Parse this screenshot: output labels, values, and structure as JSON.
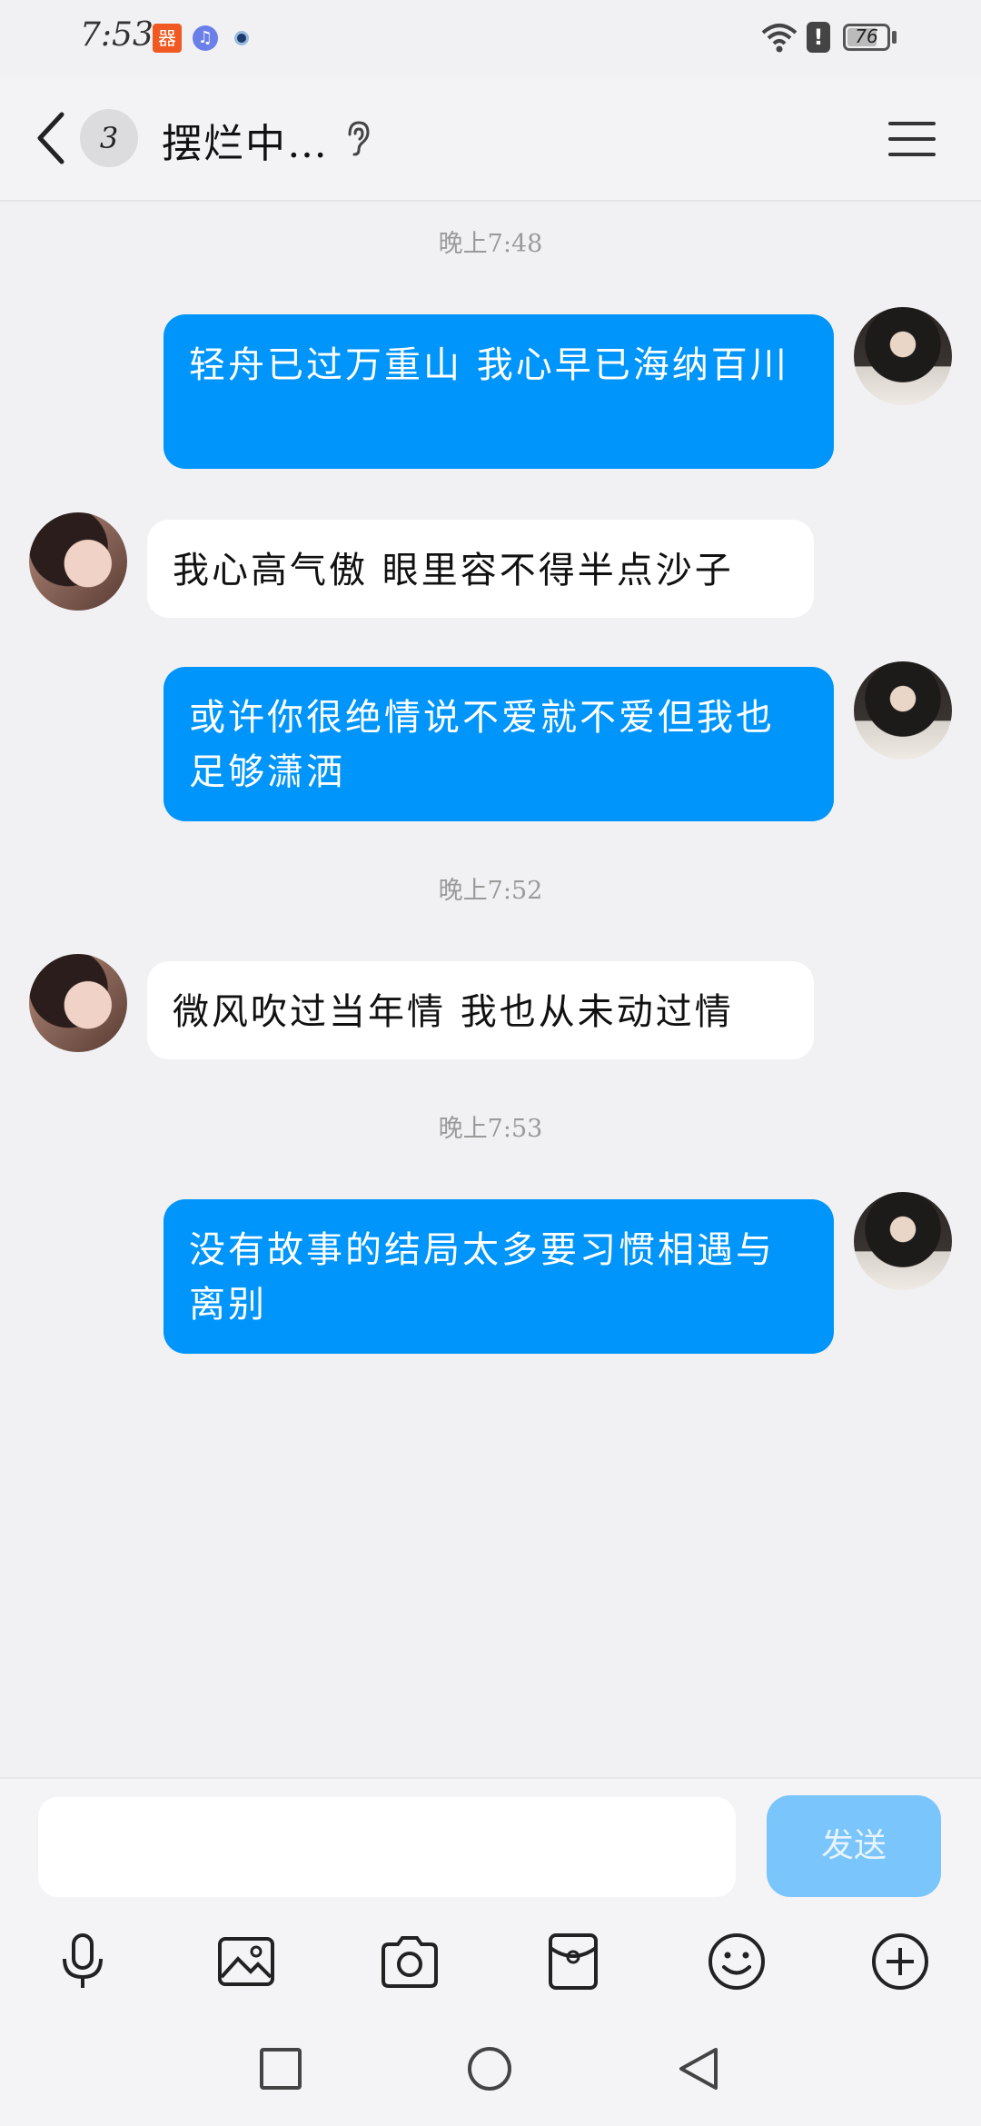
{
  "status_bar": {
    "time": "7:53",
    "app_icons": [
      "calendar-app-icon",
      "music-app-icon",
      "camera-dot-icon"
    ],
    "battery": "76",
    "battery_fraction": 0.76
  },
  "header": {
    "unread_count": "3",
    "title": "摆烂中…",
    "icons": [
      "back-icon",
      "ear-icon",
      "menu-icon"
    ]
  },
  "messages": [
    {
      "type": "timestamp",
      "text": "晚上7:48"
    },
    {
      "type": "outgoing",
      "text": "轻舟已过万重山  我心早已海纳百川"
    },
    {
      "type": "incoming",
      "text": "我心高气傲 眼里容不得半点沙子"
    },
    {
      "type": "outgoing",
      "text": "或许你很绝情说不爱就不爱但我也足够潇洒"
    },
    {
      "type": "timestamp",
      "text": "晚上7:52"
    },
    {
      "type": "incoming",
      "text": "微风吹过当年情 我也从未动过情"
    },
    {
      "type": "timestamp",
      "text": "晚上7:53"
    },
    {
      "type": "outgoing",
      "text": "没有故事的结局太多要习惯相遇与离别"
    }
  ],
  "input": {
    "value": "",
    "placeholder": "",
    "send_label": "发送"
  },
  "toolbar": [
    "microphone-icon",
    "image-icon",
    "camera-icon",
    "red-packet-icon",
    "emoji-icon",
    "plus-icon"
  ],
  "nav": [
    "recents-icon",
    "home-icon",
    "back-nav-icon"
  ],
  "colors": {
    "accent": "#0095fa",
    "send_disabled": "#7ac5fb",
    "background": "#f1f1f3"
  }
}
